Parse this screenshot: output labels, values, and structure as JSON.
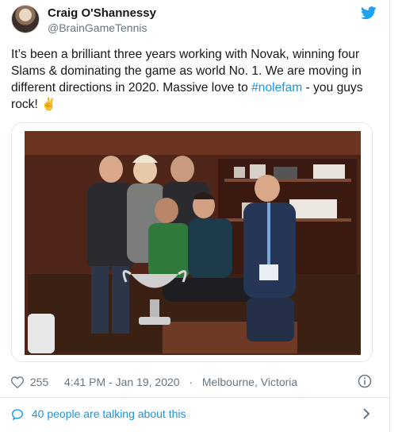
{
  "user": {
    "display_name": "Craig O'Shannessy",
    "handle": "@BrainGameTennis"
  },
  "tweet": {
    "text_part1": "It’s been a brilliant three years working with Novak, winning four Slams & dominating the game as world No. 1. We are moving in different directions in 2020. Massive love to ",
    "hashtag": "#nolefam",
    "text_part2": " - you guys rock! ",
    "emoji": "✌"
  },
  "meta": {
    "like_count": "255",
    "timestamp": "4:41 PM - Jan 19, 2020",
    "separator": "·",
    "location": "Melbourne, Victoria"
  },
  "conversation": {
    "label": "40 people are talking about this"
  },
  "icons": {
    "brand": "twitter-bird-icon",
    "like": "heart-icon",
    "info": "info-icon",
    "reply": "speech-bubble-icon",
    "more": "chevron-right-icon"
  },
  "colors": {
    "link": "#1b95e0",
    "secondary_text": "#657786",
    "primary_text": "#14171a",
    "divider": "#e1e8ed"
  }
}
